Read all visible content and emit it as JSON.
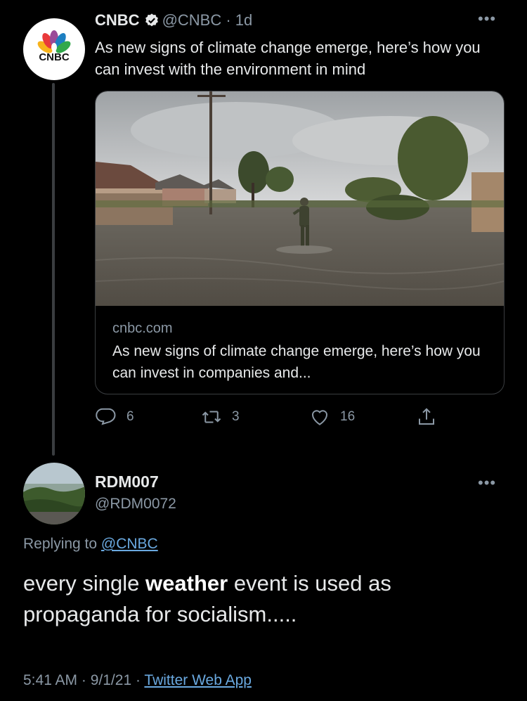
{
  "tweet": {
    "author_name": "CNBC",
    "author_handle": "@CNBC",
    "age": "1d",
    "text": "As new signs of climate change emerge, here’s how you can invest with the environment in mind",
    "avatar_text": "CNBC",
    "card": {
      "domain": "cnbc.com",
      "title": "As new signs of climate change emerge, here’s how you can invest in companies and..."
    },
    "actions": {
      "replies": "6",
      "retweets": "3",
      "likes": "16"
    }
  },
  "reply": {
    "author_name": "RDM007",
    "author_handle": "@RDM0072",
    "replying_prefix": "Replying to",
    "replying_to": "@CNBC",
    "text_before": "every single",
    "text_bold": "weather",
    "text_after": "event is used as propaganda for socialism.....",
    "time": "5:41 AM",
    "date": "9/1/21",
    "source": "Twitter Web App"
  },
  "colors": {
    "background": "#000000",
    "text": "#e7e9ea",
    "muted": "#8b98a5",
    "link": "#6aa9e0",
    "border": "#3a3d40"
  },
  "icons": [
    "verified-badge-icon",
    "more-options-icon",
    "reply-icon",
    "retweet-icon",
    "like-icon",
    "share-icon"
  ]
}
